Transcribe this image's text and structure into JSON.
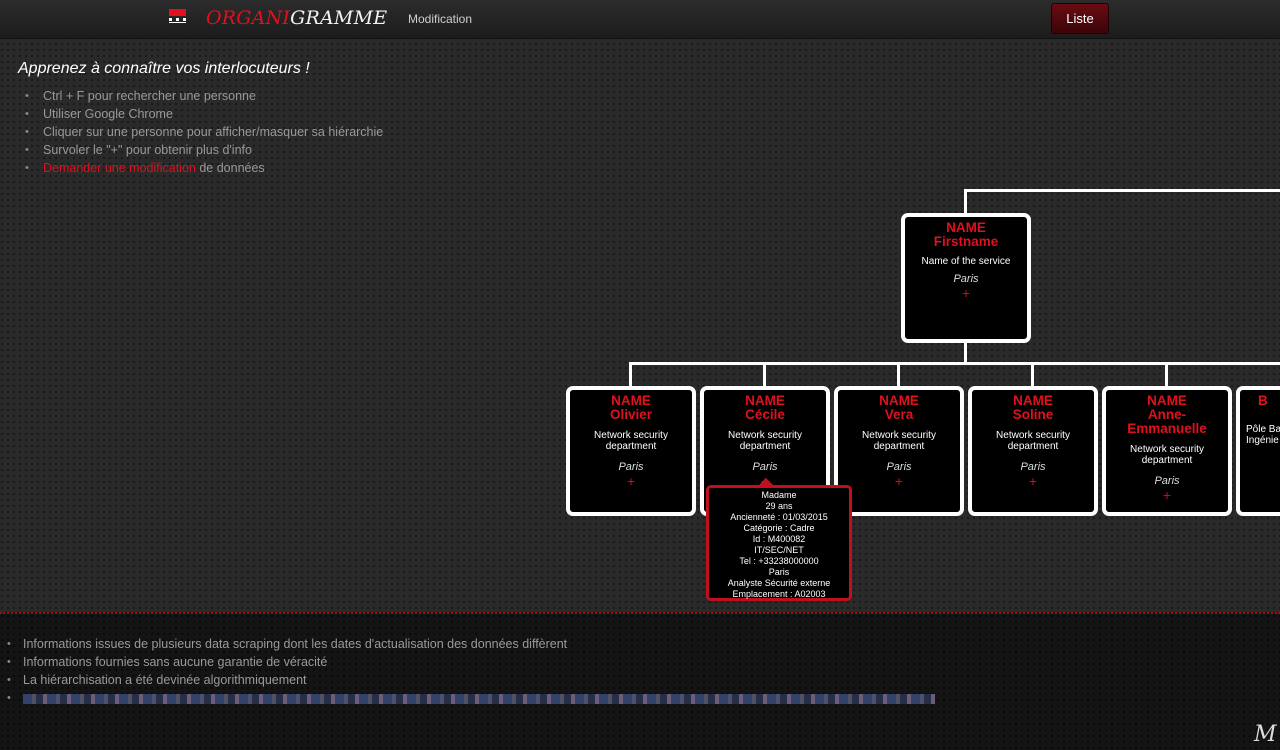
{
  "header": {
    "brand_part1": "ORGANI",
    "brand_part2": "GRAMME",
    "nav_modification": "Modification",
    "button_liste": "Liste"
  },
  "intro": {
    "title": "Apprenez à connaître vos interlocuteurs !",
    "tips": [
      "Ctrl + F pour rechercher une personne",
      "Utiliser Google Chrome",
      "Cliquer sur une personne pour afficher/masquer sa hiérarchie",
      "Survoler le \"+\" pour obtenir plus d'info"
    ],
    "request_link": "Demander une modification",
    "request_suffix": " de données"
  },
  "org": {
    "root": {
      "name": "NAME",
      "firstname": "Firstname",
      "service": "Name of the service",
      "city": "Paris",
      "plus": "+"
    },
    "children": [
      {
        "name": "NAME",
        "firstname": "Olivier",
        "service": "Network security department",
        "city": "Paris",
        "plus": "+"
      },
      {
        "name": "NAME",
        "firstname": "Cécile",
        "service": "Network security department",
        "city": "Paris",
        "plus": "+"
      },
      {
        "name": "NAME",
        "firstname": "Vera",
        "service": "Network security department",
        "city": "Paris",
        "plus": "+"
      },
      {
        "name": "NAME",
        "firstname": "Soline",
        "service": "Network security department",
        "city": "Paris",
        "plus": "+"
      },
      {
        "name": "NAME",
        "firstname": "Anne-Emmanuelle",
        "service": "Network security department",
        "city": "Paris",
        "plus": "+"
      },
      {
        "name": "B",
        "firstname": "",
        "service": "Pôle Ba Orac Ingénie c",
        "city": "",
        "plus": ""
      }
    ],
    "tooltip": [
      "Madame",
      "29 ans",
      "Ancienneté : 01/03/2015",
      "Catégorie : Cadre",
      "Id : M400082",
      "IT/SEC/NET",
      "Tel : +33238000000",
      "Paris",
      "Analyste Sécurité externe",
      "Emplacement : A02003"
    ]
  },
  "footer": {
    "notes": [
      "Informations issues de plusieurs data scraping dont les dates d'actualisation des données diffèrent",
      "Informations fournies sans aucune garantie de véracité",
      "La hiérarchisation a été devinée algorithmiquement"
    ],
    "corner_logo": "M"
  }
}
